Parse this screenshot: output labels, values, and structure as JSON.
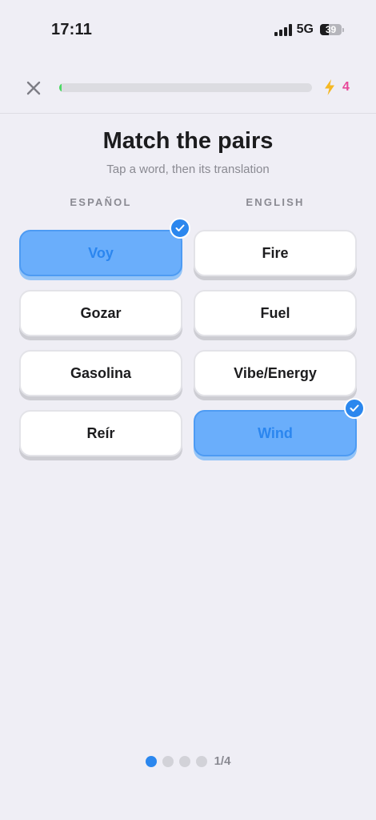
{
  "status_bar": {
    "time": "17:11",
    "network": "5G",
    "battery": "39"
  },
  "lesson": {
    "progress": 0.01,
    "streak_count": "4",
    "accent_colors": {
      "progress": "#4cd964",
      "streak": "#e8489a",
      "bolt": "#f5b823",
      "matched": "#6aaefb",
      "check": "#2b87ee"
    }
  },
  "heading": {
    "title": "Match the pairs",
    "subtitle": "Tap a word, then its translation"
  },
  "columns": {
    "left": "ESPAÑOL",
    "right": "ENGLISH"
  },
  "pairs": [
    {
      "left": {
        "label": "Voy",
        "matched": true
      },
      "right": {
        "label": "Fire",
        "matched": false
      }
    },
    {
      "left": {
        "label": "Gozar",
        "matched": false
      },
      "right": {
        "label": "Fuel",
        "matched": false
      }
    },
    {
      "left": {
        "label": "Gasolina",
        "matched": false
      },
      "right": {
        "label": "Vibe/Energy",
        "matched": false
      }
    },
    {
      "left": {
        "label": "Reír",
        "matched": false
      },
      "right": {
        "label": "Wind",
        "matched": true
      }
    }
  ],
  "pager": {
    "total": 4,
    "current": 1,
    "label": "1/4"
  }
}
